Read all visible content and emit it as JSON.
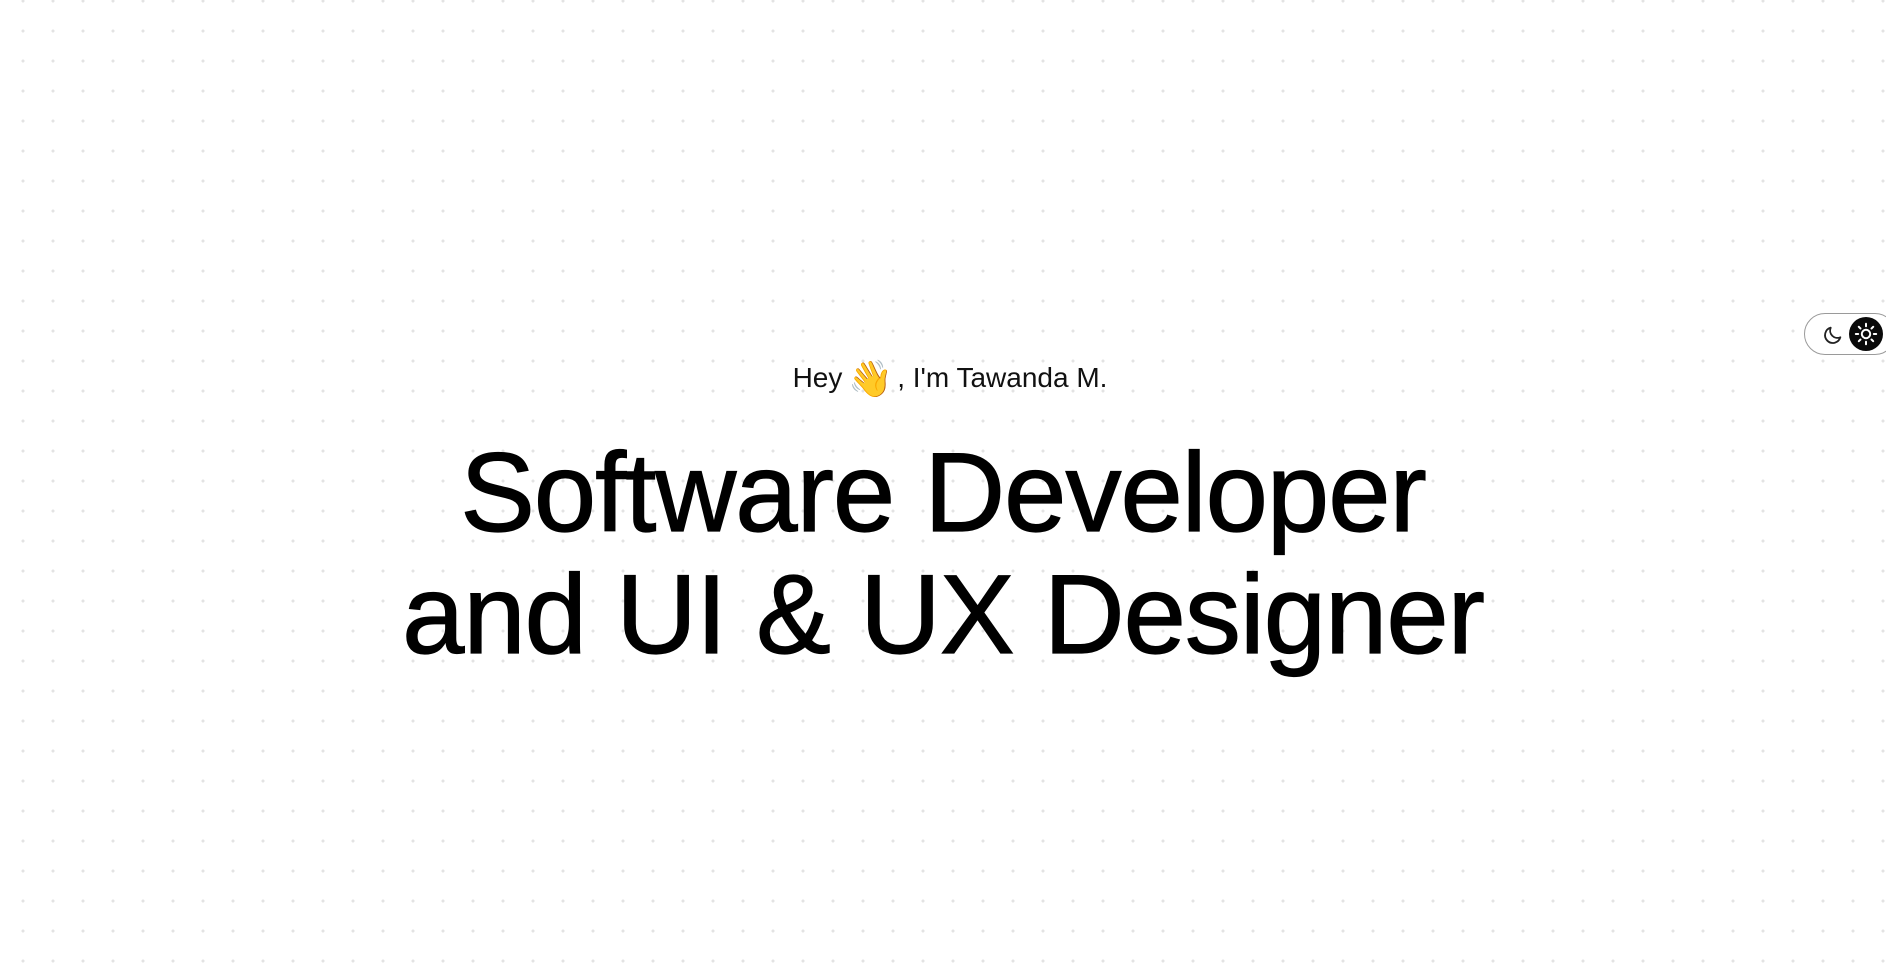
{
  "hero": {
    "greeting_prefix": "Hey",
    "greeting_emoji": "👋",
    "greeting_suffix": ", I'm Tawanda M.",
    "headline_line1": "Software Developer",
    "headline_line2": "and UI & UX Designer"
  },
  "theme_toggle": {
    "options": [
      "moon-icon",
      "sun-icon"
    ],
    "active": "sun-icon"
  },
  "colors": {
    "background": "#ffffff",
    "dot_grid": "#e3e3e3",
    "text": "#000000",
    "toggle_knob": "#0a0a0a"
  }
}
